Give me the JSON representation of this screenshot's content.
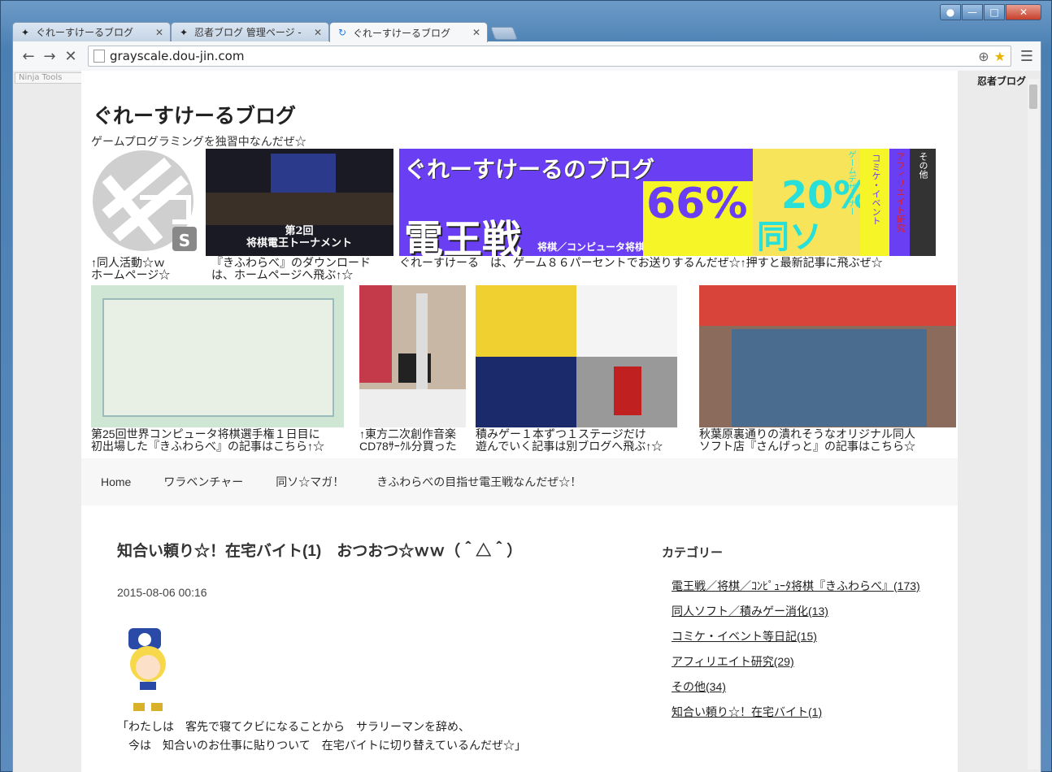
{
  "browser": {
    "tabs": [
      {
        "title": "ぐれーすけーるブログ",
        "active": false,
        "icon": "ninja-icon"
      },
      {
        "title": "忍者ブログ 管理ページ - ",
        "active": false,
        "icon": "ninja-icon"
      },
      {
        "title": "ぐれーすけーるブログ",
        "active": true,
        "icon": "loading-spinner-icon"
      }
    ],
    "url": "grayscale.dou-jin.com"
  },
  "toolbar": {
    "ninja_tools": "Ninja Tools",
    "ninja_blog": "忍者ブログ"
  },
  "site": {
    "title": "ぐれーすけーるブログ",
    "description": "ゲームプログラミングを独習中なんだぜ☆"
  },
  "banners_row1": [
    {
      "caption1": "↑同人活動☆ｗ",
      "caption2": "ホームページ☆",
      "alt": "grayscale logo"
    },
    {
      "caption1": "『きふわらべ』のダウンロード",
      "caption2": "は、ホームページへ飛ぶ↑☆",
      "alt": "第2回 将棋電王トーナメント"
    },
    {
      "caption1": "ぐれーすけーる　は、ゲーム８６パーセントでお送りするんだぜ☆↑押すと最新記事に飛ぶぜ☆",
      "caption2": "",
      "alt": "ぐれーすけーるのブログ"
    }
  ],
  "banner_text": {
    "blog": "ぐれーすけーるのブログ",
    "denou": "電王戦",
    "sub": "将棋／コンピュータ将棋",
    "pct66": "66%",
    "pct20": "20%",
    "doso": "同ソ",
    "v1": "ゲームデザイナー",
    "v2": "コミケ・イベント",
    "v3": "アフィリエイト研究",
    "v4": "その他",
    "tournament": "第2回\n将棋電王トーナメント"
  },
  "banners_row2": [
    {
      "caption1": "第25回世界コンピュータ将棋選手権１日目に",
      "caption2": "初出場した『きふわらべ』の記事はこちら↑☆"
    },
    {
      "caption1": "↑東方二次創作音楽",
      "caption2": "CD78ｻｰｸﾙ分買った"
    },
    {
      "caption1": "積みゲー１本ずつ１ステージだけ",
      "caption2": "遊んでいく記事は別ブログへ飛ぶ↑☆"
    },
    {
      "caption1": "秋葉原裏通りの潰れそうなオリジナル同人",
      "caption2": "ソフト店『さんげっと』の記事はこちら☆"
    }
  ],
  "nav": {
    "items": [
      "Home",
      "ワラベンチャー",
      "同ソ☆マガ！",
      "きふわらべの目指せ電王戦なんだぜ☆！"
    ]
  },
  "post": {
    "title": "知合い頼り☆！在宅バイト(1)　おつおつ☆ｗｗ（＾△＾）",
    "date": "2015-08-06 00:16",
    "body_line1": "「わたしは　客先で寝てクビになることから　サラリーマンを辞め、",
    "body_line2": "　今は　知合いのお仕事に貼りついて　在宅バイトに切り替えているんだぜ☆」"
  },
  "sidebar": {
    "title": "カテゴリー",
    "categories": [
      "電王戦／将棋／ｺﾝﾋﾟｭｰﾀ将棋『きふわらべ』(173)",
      "同人ソフト／積みゲー消化(13)",
      "コミケ・イベント等日記(15)",
      "アフィリエイト研究(29)",
      "その他(34)",
      "知合い頼り☆！在宅バイト(1)"
    ]
  },
  "colors": {
    "banner_purple": "#6a3ef2",
    "banner_yellow": "#f5f528",
    "frame_blue": "#4a7fb3"
  }
}
